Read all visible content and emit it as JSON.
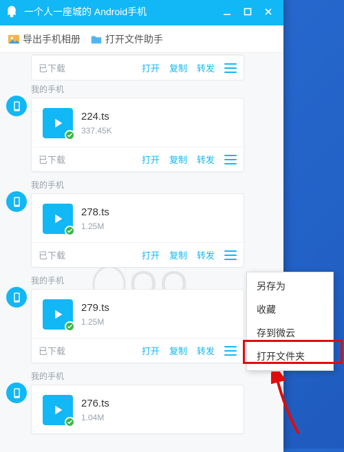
{
  "titlebar": {
    "title": "一个人一座城的 Android手机"
  },
  "toolbar": {
    "export_album": "导出手机相册",
    "open_file_helper": "打开文件助手"
  },
  "labels": {
    "sender": "我的手机",
    "status_downloaded": "已下载",
    "open": "打开",
    "copy": "复制",
    "forward": "转发"
  },
  "context_menu": {
    "save_as": "另存为",
    "favorite": "收藏",
    "save_to_cloud": "存到微云",
    "open_folder": "打开文件夹"
  },
  "files": [
    {
      "name": "224.ts",
      "size": "337.45K"
    },
    {
      "name": "278.ts",
      "size": "1.25M"
    },
    {
      "name": "279.ts",
      "size": "1.25M"
    },
    {
      "name": "276.ts",
      "size": "1.04M"
    }
  ],
  "watermark": "QQ"
}
